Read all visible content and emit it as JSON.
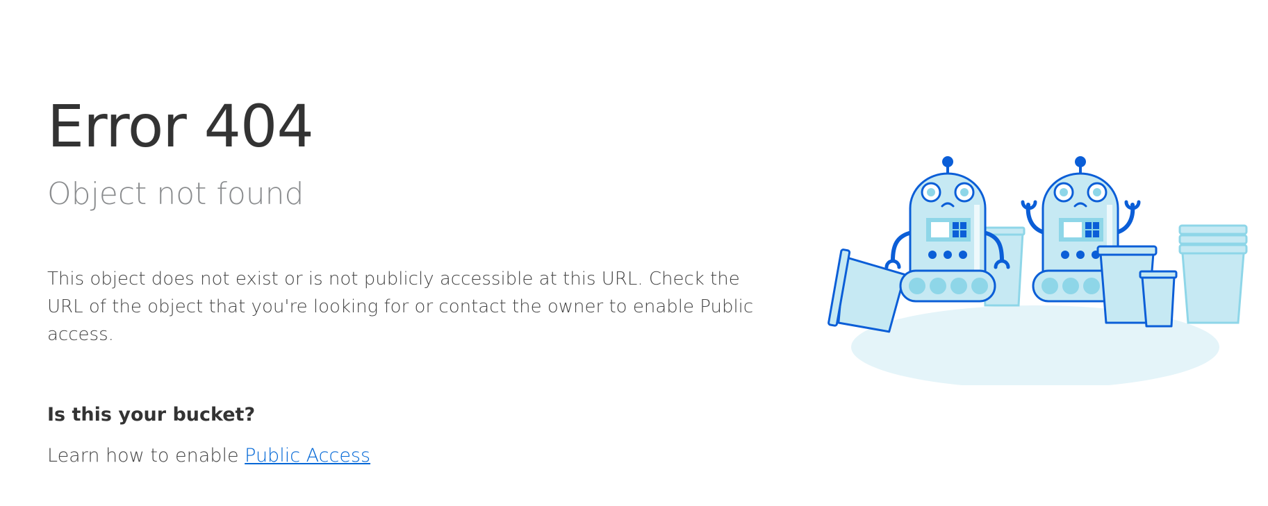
{
  "page": {
    "title": "Error 404",
    "subtitle": "Object not found",
    "description": "This object does not exist or is not publicly accessible at this URL. Check the URL of the object that you're looking for or contact the owner to enable Public access.",
    "bucket_heading": "Is this your bucket?",
    "learn_prefix": "Learn how to enable ",
    "learn_link": "Public Access"
  },
  "illustration": {
    "icon": "sad-robots-with-buckets-illustration",
    "colors": {
      "outline": "#0b5ed7",
      "fill": "#c6e9f3",
      "fill_light": "#e4f4f9",
      "accent": "#8ed6e8"
    }
  }
}
